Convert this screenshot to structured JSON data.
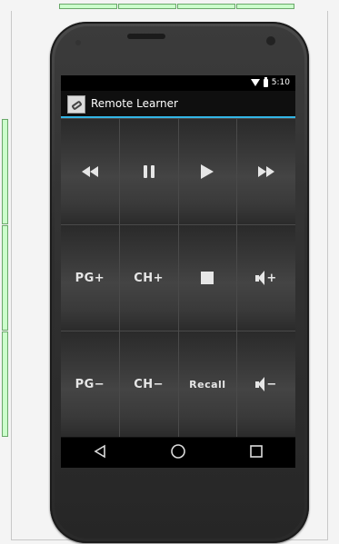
{
  "status": {
    "time": "5:10"
  },
  "app": {
    "title": "Remote Learner",
    "accent": "#33b5e5"
  },
  "buttons": {
    "rewind": {
      "icon": "rewind-icon"
    },
    "pause": {
      "icon": "pause-icon"
    },
    "play": {
      "icon": "play-icon"
    },
    "fast_forward": {
      "icon": "fast-forward-icon"
    },
    "page_up": {
      "label": "PG+"
    },
    "channel_up": {
      "label": "CH+"
    },
    "stop": {
      "icon": "stop-icon"
    },
    "volume_up": {
      "label": "+"
    },
    "page_down": {
      "label": "PG−"
    },
    "channel_down": {
      "label": "CH−"
    },
    "recall": {
      "label": "Recall"
    },
    "volume_down": {
      "label": "−"
    }
  },
  "navbar": {
    "back": "back-icon",
    "home": "home-icon",
    "recents": "recents-icon"
  }
}
